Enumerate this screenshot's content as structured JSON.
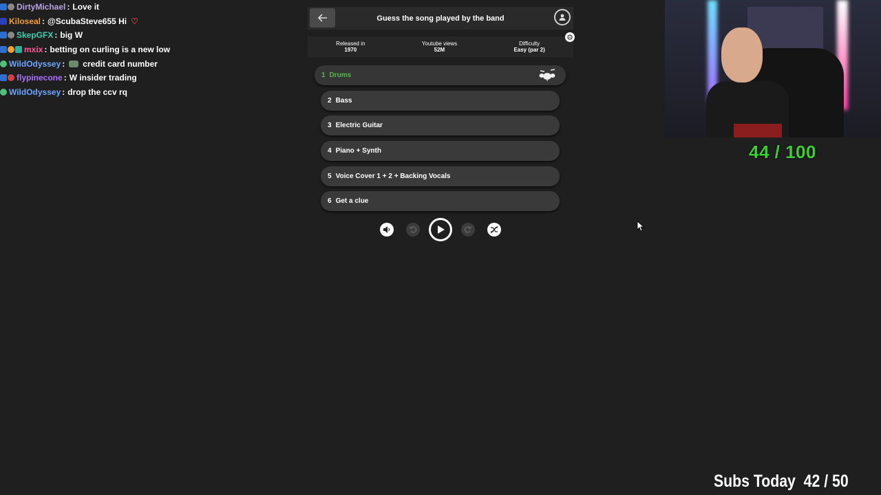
{
  "chat": [
    {
      "user": "DirtyMichael",
      "user_color": "#b9a3e3",
      "message": "Love it",
      "badges": [
        "#2b6fd1",
        "#888888"
      ]
    },
    {
      "user": "Kiloseal",
      "user_color": "#f0a030",
      "message": "@ScubaSteve655 Hi",
      "badges": [
        "#2b3fb8"
      ],
      "heart": "♡"
    },
    {
      "user": "SkepGFX",
      "user_color": "#3fd0b0",
      "message": "big W",
      "badges": [
        "#2b6fd1",
        "#888888"
      ]
    },
    {
      "user": "mxix",
      "user_color": "#ff5a9b",
      "message": "betting on curling is a new low",
      "badges": [
        "#2b6fd1",
        "#f0a030",
        "#2bb0a0"
      ]
    },
    {
      "user": "WildOdyssey",
      "user_color": "#6aa6ff",
      "message": "credit card number",
      "badges": [
        "#4fbf7a"
      ],
      "emote": true
    },
    {
      "user": "flypinecone",
      "user_color": "#a970ff",
      "message": "W insider trading",
      "badges": [
        "#2b6fd1",
        "#d04040"
      ]
    },
    {
      "user": "WildOdyssey",
      "user_color": "#6aa6ff",
      "message": "drop the ccv rq",
      "badges": [
        "#4fbf7a"
      ]
    }
  ],
  "game": {
    "title": "Guess the song played by the band",
    "info": [
      {
        "label": "Released in",
        "value": "1970"
      },
      {
        "label": "Youtube views",
        "value": "52M"
      },
      {
        "label": "Difficulty",
        "value": "Easy (par 2)"
      }
    ],
    "stems": [
      {
        "num": "1",
        "label": "Drums"
      },
      {
        "num": "2",
        "label": "Bass"
      },
      {
        "num": "3",
        "label": "Electric Guitar"
      },
      {
        "num": "4",
        "label": "Piano + Synth"
      },
      {
        "num": "5",
        "label": "Voice Cover 1 + 2 + Backing Vocals"
      },
      {
        "num": "6",
        "label": "Get a clue"
      }
    ],
    "active_color": "#56b84c"
  },
  "overlay": {
    "score": "44 / 100",
    "subs": "Subs Today  42 / 50"
  }
}
